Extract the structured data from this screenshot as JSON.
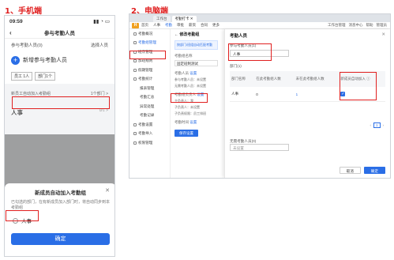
{
  "headings": {
    "mobile": "1、手机端",
    "desktop": "2、电脑端"
  },
  "mobile": {
    "time": "09:59",
    "status_icons": "▮▮ ◔ ▭",
    "title": "参与考勤人员",
    "back": "‹",
    "participants_label": "参与考勤人员(0)",
    "participants_action": "选择人员",
    "add_label": "新增参与考勤人员",
    "chips": [
      "员工 1人",
      "部门1个"
    ],
    "auto_join_label": "新员工自动加入考勤组",
    "auto_join_value": "1个部门 >",
    "group_name": "人事",
    "group_count": "0/1 >",
    "sheet_title": "新成员自动加入考勤组",
    "sheet_close": "✕",
    "sheet_desc": "已勾选的部门，在有新成员加入部门时，将自动同步到本考勤组",
    "option": "人事",
    "confirm": "确定"
  },
  "desktop": {
    "tabs": [
      "工作台",
      "考勤打卡 ✕"
    ],
    "nav": [
      "首页",
      "人事",
      "考勤",
      "审批",
      "薪资",
      "合同",
      "更多"
    ],
    "top_right": [
      "工作台管理",
      "消息中心",
      "帮助",
      "管理员"
    ],
    "sidebar": [
      "考勤概况",
      "考勤组管理",
      "班次管理",
      "加班规则",
      "假期管理",
      "考勤统计",
      "报表管理",
      "考勤汇总",
      "异常处理",
      "考勤记录",
      "考勤设置",
      "考勤导入",
      "权限管理"
    ],
    "main": {
      "title": "← 修改考勤组",
      "notice": "按部门/班组自动匹配考勤",
      "name_label": "考勤组名称",
      "name_value": "固定班制测试",
      "members_label": "考勤人员",
      "members_link": "设置",
      "members_line1": "参与考勤人员：未设置",
      "members_line2": "无需考勤人员：未设置",
      "admin_label": "考勤组负责人",
      "admin_link": "设置",
      "admin_line1": "主负责人：我",
      "admin_line2": "子负责人：未设置",
      "admin_line3": "子负责权限：员工排班",
      "time_label": "考勤时间",
      "time_link": "设置",
      "save": "保存设置"
    },
    "panel": {
      "title": "考勤人员",
      "close": "✕",
      "participants_label": "参与考勤人员(1)",
      "participants_value": "人事",
      "dept_label": "部门(1)",
      "columns": [
        "部门名称",
        "在此考勤组人数",
        "未在此考勤组人数",
        "新成员自动加入 ⓘ"
      ],
      "row": {
        "name": "人事",
        "in": "0",
        "out": "1",
        "check": "✓"
      },
      "pager_prev": "‹",
      "pager_page": "1",
      "pager_next": "›",
      "exempt_label": "无需考勤人员(0)",
      "exempt_value": "未设置",
      "cancel": "取消",
      "ok": "确定"
    }
  }
}
